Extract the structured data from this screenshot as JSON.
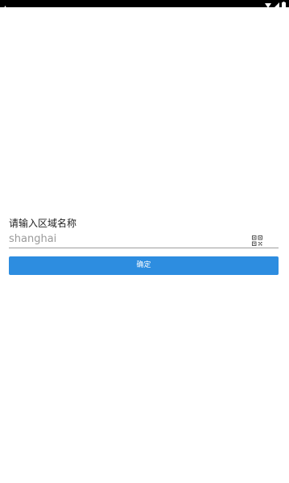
{
  "status_bar": {
    "left_icon": "warning-triangle-icon",
    "right_icons": [
      "wifi-icon",
      "signal-icon",
      "battery-icon"
    ]
  },
  "form": {
    "label": "请输入区域名称",
    "input_placeholder": "shanghai",
    "input_value": "",
    "qr_icon": "qr-code-scan-icon",
    "confirm_label": "确定"
  },
  "colors": {
    "accent": "#2d8de0",
    "status_bar": "#000000",
    "background": "#ffffff"
  }
}
